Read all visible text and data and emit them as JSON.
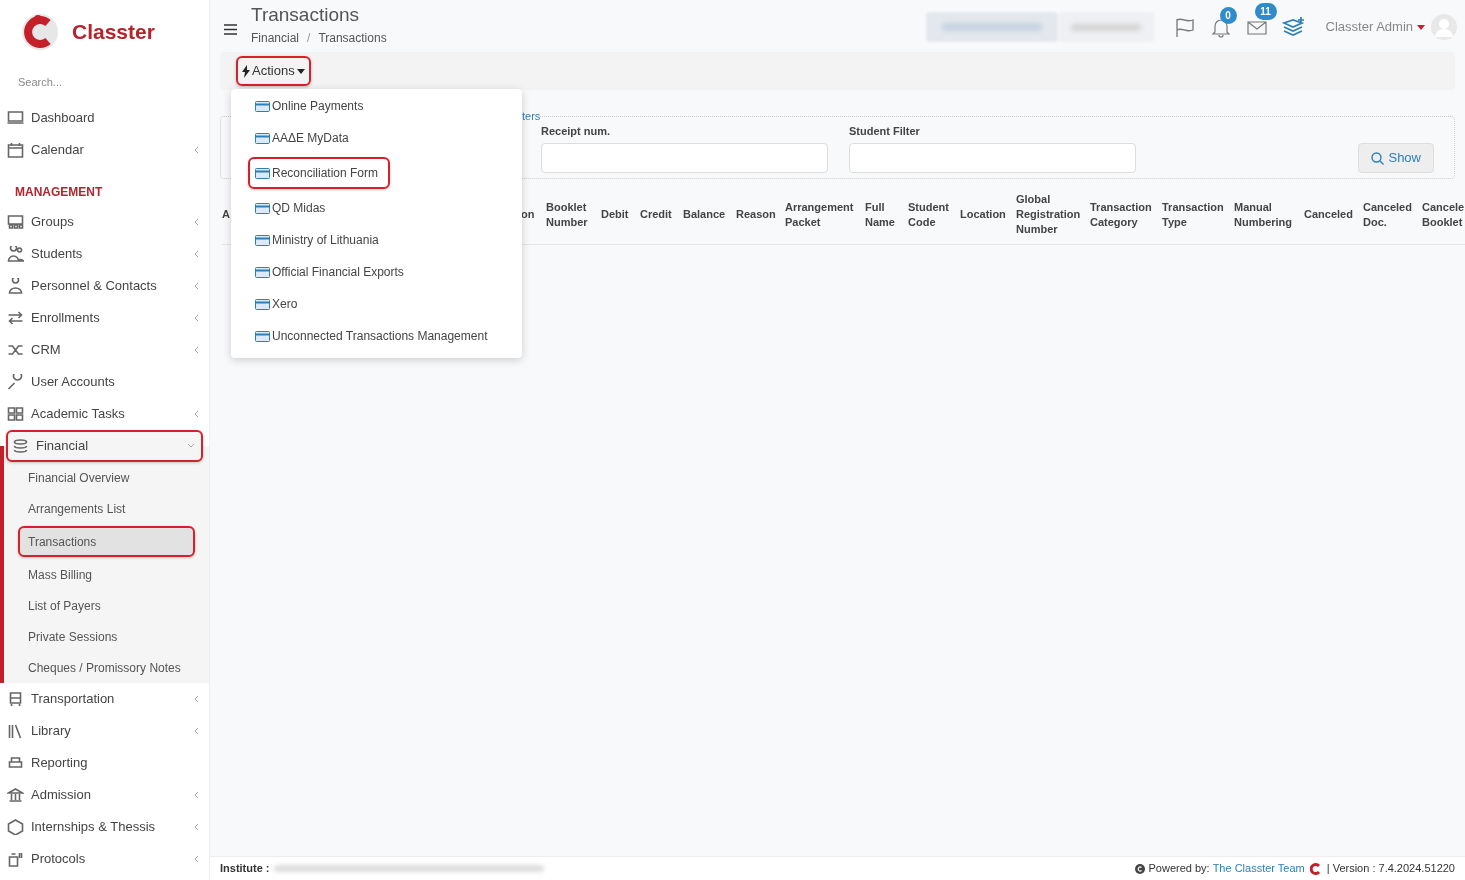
{
  "brand": {
    "name": "Classter"
  },
  "sidebar": {
    "search": {
      "placeholder": "Search..."
    },
    "items": [
      {
        "kind": "item",
        "label": "Dashboard",
        "expandable": false
      },
      {
        "kind": "item",
        "label": "Calendar",
        "expandable": true
      },
      {
        "kind": "section",
        "label": "MANAGEMENT"
      },
      {
        "kind": "item",
        "label": "Groups",
        "expandable": true
      },
      {
        "kind": "item",
        "label": "Students",
        "expandable": true
      },
      {
        "kind": "item",
        "label": "Personnel & Contacts",
        "expandable": true
      },
      {
        "kind": "item",
        "label": "Enrollments",
        "expandable": true
      },
      {
        "kind": "item",
        "label": "CRM",
        "expandable": true
      },
      {
        "kind": "item",
        "label": "User Accounts",
        "expandable": false
      },
      {
        "kind": "item",
        "label": "Academic Tasks",
        "expandable": true
      },
      {
        "kind": "item",
        "label": "Financial",
        "expandable": true,
        "expanded": true,
        "highlighted": true,
        "children": [
          {
            "label": "Financial Overview",
            "selected": false,
            "highlighted": false
          },
          {
            "label": "Arrangements List",
            "selected": false,
            "highlighted": false
          },
          {
            "label": "Transactions",
            "selected": true,
            "highlighted": true
          },
          {
            "label": "Mass Billing",
            "selected": false,
            "highlighted": false
          },
          {
            "label": "List of Payers",
            "selected": false,
            "highlighted": false
          },
          {
            "label": "Private Sessions",
            "selected": false,
            "highlighted": false
          },
          {
            "label": "Cheques / Promissory Notes",
            "selected": false,
            "highlighted": false
          }
        ]
      },
      {
        "kind": "item",
        "label": "Transportation",
        "expandable": true
      },
      {
        "kind": "item",
        "label": "Library",
        "expandable": true
      },
      {
        "kind": "item",
        "label": "Reporting",
        "expandable": false
      },
      {
        "kind": "item",
        "label": "Admission",
        "expandable": true
      },
      {
        "kind": "item",
        "label": "Internships & Thessis",
        "expandable": true
      },
      {
        "kind": "item",
        "label": "Protocols",
        "expandable": true
      }
    ]
  },
  "header": {
    "title": "Transactions",
    "breadcrumb": [
      "Financial",
      "/",
      "Transactions"
    ],
    "notifications": "0",
    "messages": "11",
    "user": "Classter Admin"
  },
  "actions": {
    "label": "Actions",
    "highlighted": true,
    "menu": [
      {
        "label": "Online Payments",
        "highlighted": false
      },
      {
        "label": "ΑΑΔΕ MyData",
        "highlighted": false
      },
      {
        "label": "Reconciliation Form",
        "highlighted": true
      },
      {
        "label": "QD Midas",
        "highlighted": false
      },
      {
        "label": "Ministry of Lithuania",
        "highlighted": false
      },
      {
        "label": "Official Financial Exports",
        "highlighted": false
      },
      {
        "label": "Xero",
        "highlighted": false
      },
      {
        "label": "Unconnected Transactions Management",
        "highlighted": false
      }
    ]
  },
  "filters": {
    "link": "ters",
    "fields": [
      {
        "label": "Receipt num."
      },
      {
        "label": "Student Filter"
      }
    ],
    "show_button": "Show"
  },
  "table": {
    "columns": [
      "A",
      "on",
      "Booklet Number",
      "Debit",
      "Credit",
      "Balance",
      "Reason",
      "Arrangement Packet",
      "Full Name",
      "Student Code",
      "Location",
      "Global Registration Number",
      "Transaction Category",
      "Transaction Type",
      "Manual Numbering",
      "Canceled",
      "Canceled Doc.",
      "Cancele Booklet"
    ]
  },
  "footer": {
    "institute_label": "Institute :",
    "powered_by": "Powered by:",
    "team_link": "The Classter Team",
    "version": "| Version : 7.4.2024.51220"
  }
}
